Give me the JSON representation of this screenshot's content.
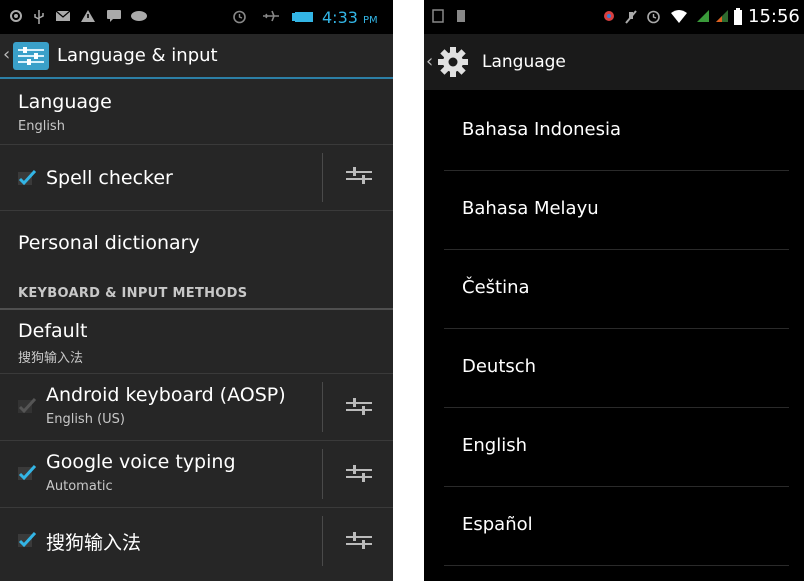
{
  "left": {
    "status": {
      "time": "4:33",
      "ampm": "PM",
      "icons": [
        "gps-icon",
        "usb-icon",
        "email-icon",
        "warning-icon",
        "chat-icon",
        "gamepad-icon",
        "alarm-icon",
        "airplane-icon",
        "battery-icon"
      ],
      "accent": "#33b5e5"
    },
    "actionbar": {
      "title": "Language & input",
      "icon": "settings-sliders-icon"
    },
    "language": {
      "title": "Language",
      "summary": "English"
    },
    "spell_checker": {
      "title": "Spell checker",
      "checked": true
    },
    "personal_dictionary": {
      "title": "Personal dictionary"
    },
    "section_header": "KEYBOARD & INPUT METHODS",
    "default": {
      "title": "Default",
      "summary": "搜狗输入法"
    },
    "android_keyboard": {
      "title": "Android keyboard (AOSP)",
      "summary": "English (US)",
      "checked": true,
      "disabled": true
    },
    "google_voice": {
      "title": "Google voice typing",
      "summary": "Automatic",
      "checked": true
    },
    "sogou": {
      "title": "搜狗输入法",
      "checked": true
    }
  },
  "right": {
    "status": {
      "time": "15:56",
      "icons": [
        "sim-icon",
        "sd-card-icon",
        "location-icon",
        "mute-icon",
        "alarm-icon",
        "wifi-icon",
        "signal-icon",
        "signal-icon",
        "battery-icon"
      ]
    },
    "actionbar": {
      "title": "Language",
      "icon": "gear-icon"
    },
    "languages": [
      "Bahasa Indonesia",
      "Bahasa Melayu",
      "Čeština",
      "Deutsch",
      "English",
      "Español"
    ]
  }
}
